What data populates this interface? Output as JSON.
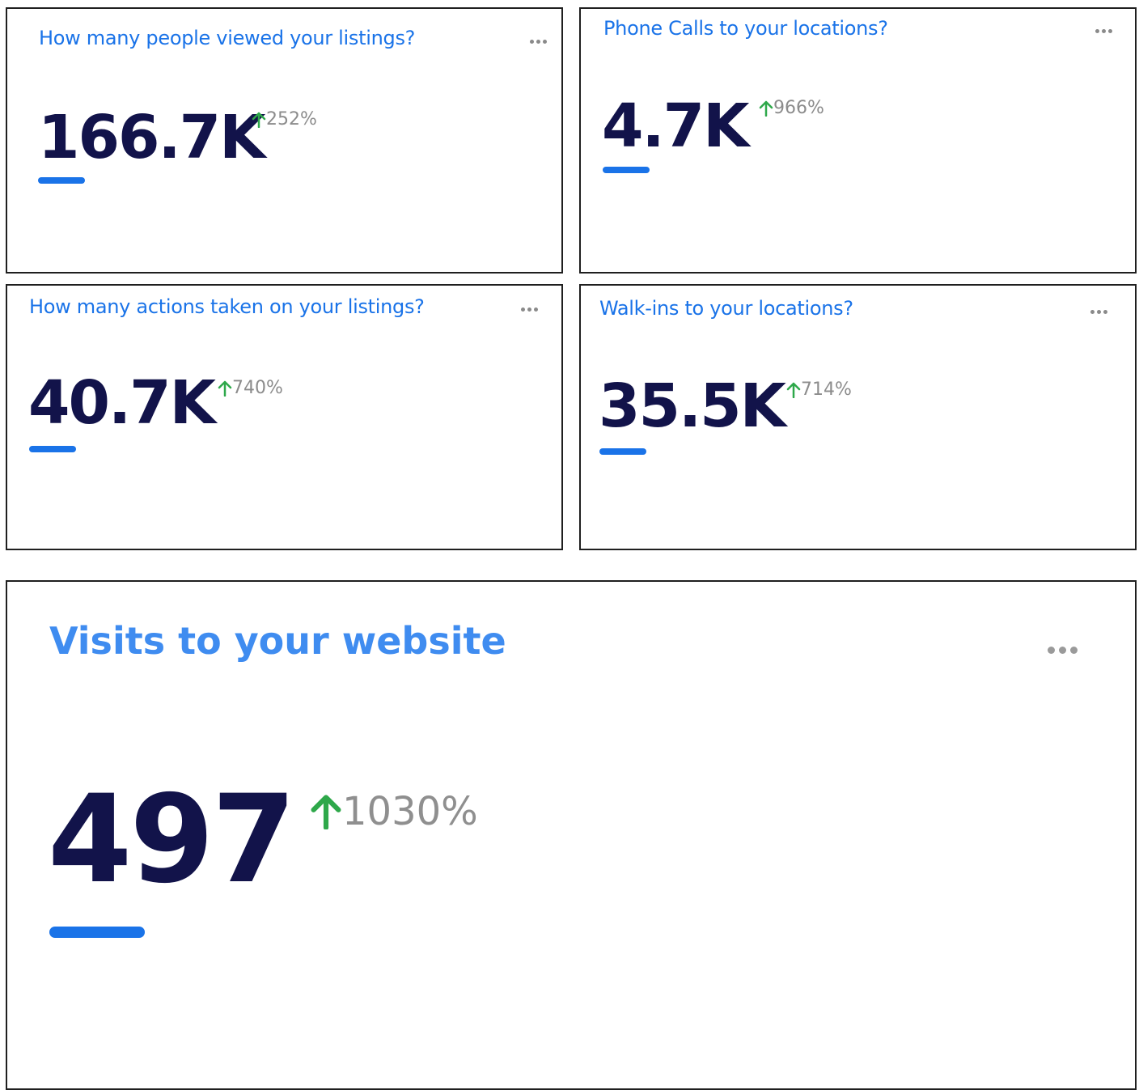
{
  "colors": {
    "title": "#1a73e8",
    "value": "#12134a",
    "accent_bar": "#1a73e8",
    "delta_up_arrow": "#2ea84a",
    "delta_text": "#8c8c8c",
    "card_border": "#1f1f1f"
  },
  "cards": [
    {
      "title": "How many people viewed your listings?",
      "value": "166.7K",
      "delta": "252%",
      "delta_direction": "up",
      "menu_icon": "more-horizontal-icon"
    },
    {
      "title": "Phone Calls to your locations?",
      "value": "4.7K",
      "delta": "966%",
      "delta_direction": "up",
      "menu_icon": "more-horizontal-icon"
    },
    {
      "title": "How many actions taken on your listings?",
      "value": "40.7K",
      "delta": "740%",
      "delta_direction": "up",
      "menu_icon": "more-horizontal-icon"
    },
    {
      "title": "Walk-ins to your locations?",
      "value": "35.5K",
      "delta": "714%",
      "delta_direction": "up",
      "menu_icon": "more-horizontal-icon"
    },
    {
      "title": "Visits to your website",
      "value": "497",
      "delta": "1030%",
      "delta_direction": "up",
      "menu_icon": "more-horizontal-icon"
    }
  ]
}
